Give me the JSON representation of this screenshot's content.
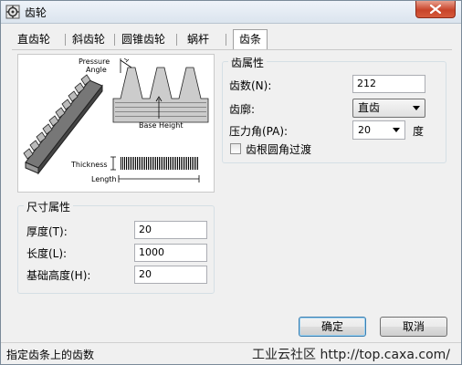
{
  "window": {
    "title": "齿轮"
  },
  "tabs": [
    {
      "label": "直齿轮"
    },
    {
      "label": "斜齿轮"
    },
    {
      "label": "圆锥齿轮"
    },
    {
      "label": "蜗杆"
    },
    {
      "label": "齿条",
      "active": true
    }
  ],
  "illustration": {
    "pressure_angle": "Pressure Angle",
    "pressure_line1": "Pressure",
    "pressure_line2": "Angle",
    "base_height": "Base Height",
    "thickness": "Thickness",
    "length": "Length"
  },
  "tooth_props": {
    "title": "齿属性",
    "count_label": "齿数(N):",
    "count_value": "212",
    "profile_label": "齿廓:",
    "profile_value": "直齿",
    "pressure_label": "压力角(PA):",
    "pressure_value": "20",
    "pressure_unit": "度",
    "fillet_label": "齿根圆角过渡",
    "fillet_checked": false
  },
  "size_props": {
    "title": "尺寸属性",
    "thickness_label": "厚度(T):",
    "thickness_value": "20",
    "length_label": "长度(L):",
    "length_value": "1000",
    "base_label": "基础高度(H):",
    "base_value": "20"
  },
  "buttons": {
    "ok": "确定",
    "cancel": "取消"
  },
  "status": {
    "text": "指定齿条上的齿数",
    "watermark": "工业云社区 http://top.caxa.com/"
  },
  "colors": {
    "close": "#c8442a",
    "default_button_border": "#3c7fb1"
  }
}
